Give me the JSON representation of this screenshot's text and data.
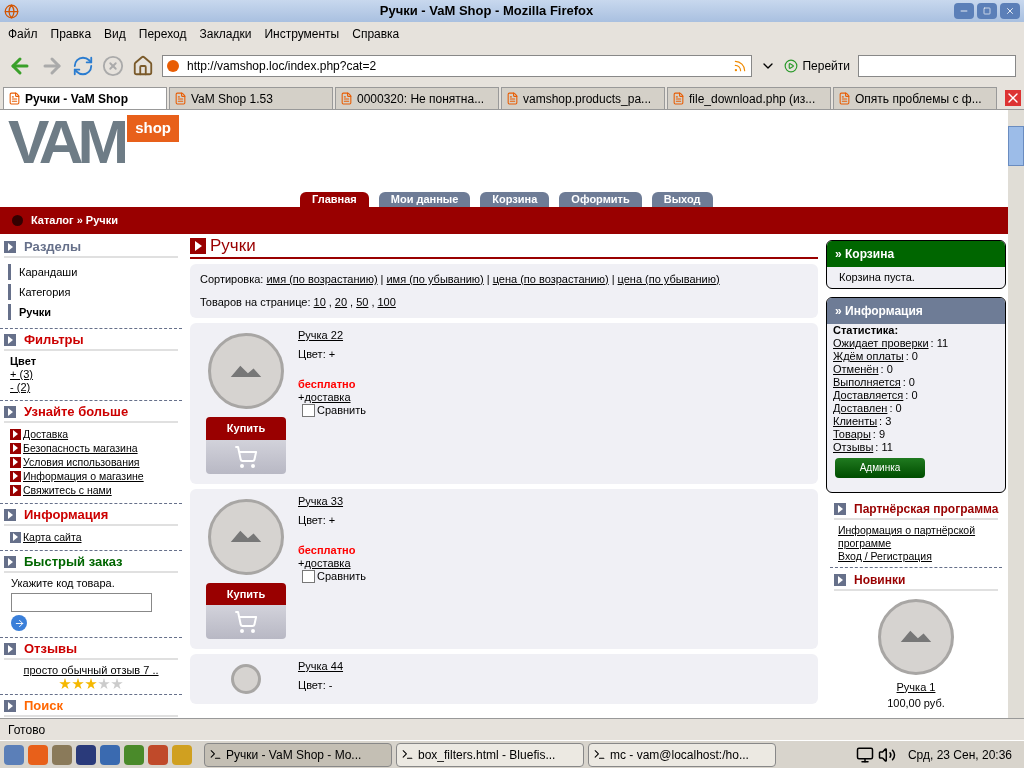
{
  "window": {
    "title": "Ручки - VaM Shop - Mozilla Firefox"
  },
  "menu": [
    "Файл",
    "Правка",
    "Вид",
    "Переход",
    "Закладки",
    "Инструменты",
    "Справка"
  ],
  "toolbar": {
    "url": "http://vamshop.loc/index.php?cat=2",
    "go": "Перейти"
  },
  "tabs": [
    {
      "label": "Ручки - VaM Shop",
      "selected": true
    },
    {
      "label": "VaM Shop 1.53",
      "selected": false
    },
    {
      "label": "0000320: Не понятна...",
      "selected": false
    },
    {
      "label": "vamshop.products_pa...",
      "selected": false
    },
    {
      "label": "file_download.php (из...",
      "selected": false
    },
    {
      "label": "Опять проблемы с ф...",
      "selected": false
    }
  ],
  "site": {
    "logo": {
      "letters": "VAM",
      "badge": "shop"
    },
    "nav": [
      {
        "label": "Главная",
        "selected": true
      },
      {
        "label": "Мои данные",
        "selected": false
      },
      {
        "label": "Корзина",
        "selected": false
      },
      {
        "label": "Оформить",
        "selected": false
      },
      {
        "label": "Выход",
        "selected": false
      }
    ],
    "breadcrumb": "Каталог » Ручки"
  },
  "left": [
    {
      "kind": "categories",
      "title": "Разделы",
      "color": "#66708a",
      "items": [
        {
          "label": "Карандаши",
          "selected": false
        },
        {
          "label": "Категория",
          "selected": false
        },
        {
          "label": "Ручки",
          "selected": true
        }
      ]
    },
    {
      "kind": "filters",
      "title": "Фильтры",
      "color": "#cc0000",
      "group": "Цвет",
      "links": [
        "+ (3)",
        "- (2)"
      ]
    },
    {
      "kind": "links",
      "title": "Узнайте больше",
      "color": "#cc0000",
      "items": [
        {
          "label": "Доставка",
          "color": "#990000"
        },
        {
          "label": "Безопасность магазина",
          "color": "#990000"
        },
        {
          "label": "Условия использования",
          "color": "#990000"
        },
        {
          "label": "Информация о магазине",
          "color": "#990000"
        },
        {
          "label": "Свяжитесь с нами",
          "color": "#990000"
        }
      ]
    },
    {
      "kind": "links",
      "title": "Информация",
      "color": "#cc0000",
      "items": [
        {
          "label": "Карта сайта",
          "color": "#66708a"
        }
      ]
    },
    {
      "kind": "quick",
      "title": "Быстрый заказ",
      "color": "#006600",
      "hint": "Укажите код товара."
    },
    {
      "kind": "reviews",
      "title": "Отзывы",
      "color": "#cc0000",
      "review": "просто обычный отзыв 7 ..",
      "stars": 3
    },
    {
      "kind": "title",
      "title": "Поиск",
      "color": "#ff6600"
    }
  ],
  "center": {
    "heading": "Ручки",
    "sort": {
      "label": "Сортировка:",
      "separator": "|",
      "options": [
        "имя (по возрастанию)",
        "имя (по убыванию)",
        "цена (по возрастанию)",
        "цена (по убыванию)"
      ]
    },
    "per_page": {
      "label": "Товаров на странице:",
      "separator": ",",
      "options": [
        "10",
        "20",
        "50",
        "100"
      ]
    },
    "products": [
      {
        "name": "Ручка 22",
        "color_line": "Цвет: +",
        "price": "бесплатно",
        "shipping_prefix": "+",
        "shipping": "доставка",
        "buy": "Купить",
        "compare": {
          "label": "Сравнить",
          "checked": false
        }
      },
      {
        "name": "Ручка 33",
        "color_line": "Цвет: +",
        "price": "бесплатно",
        "shipping_prefix": "+",
        "shipping": "доставка",
        "buy": "Купить",
        "compare": {
          "label": "Сравнить",
          "checked": false
        }
      },
      {
        "name": "Ручка 44",
        "color_line": "Цвет: -"
      }
    ]
  },
  "right": {
    "cart": {
      "title": "» Корзина",
      "text": "Корзина пуста."
    },
    "info": {
      "title": "» Информация",
      "stats_title": "Статистика:",
      "stats": [
        {
          "label": "Ожидает проверки",
          "suffix": ": 11"
        },
        {
          "label": "Ждём оплаты",
          "suffix": ": 0"
        },
        {
          "label": "Отменён",
          "suffix": ": 0"
        },
        {
          "label": "Выполняется",
          "suffix": ": 0"
        },
        {
          "label": "Доставляется",
          "suffix": ": 0"
        },
        {
          "label": "Доставлен",
          "suffix": ": 0"
        },
        {
          "label": "Клиенты",
          "suffix": ": 3"
        },
        {
          "label": "Товары",
          "suffix": ": 9"
        },
        {
          "label": "Отзывы",
          "suffix": ": 11"
        }
      ],
      "button": "Админка"
    },
    "partner": {
      "title": "Партнёрская программа",
      "links": [
        "Информация о партнёрской программе",
        "Вход / Регистрация"
      ]
    },
    "new": {
      "title": "Новинки",
      "name": "Ручка 1",
      "price": "100,00 руб."
    }
  },
  "status": "Готово",
  "taskbar": {
    "items": [
      {
        "label": "Ручки - VaM Shop - Mo...",
        "selected": true
      },
      {
        "label": "box_filters.html - Bluefis...",
        "selected": false
      },
      {
        "label": "mc - vam@localhost:/ho...",
        "selected": false
      }
    ],
    "clock": "Срд, 23 Сен, 20:36"
  }
}
